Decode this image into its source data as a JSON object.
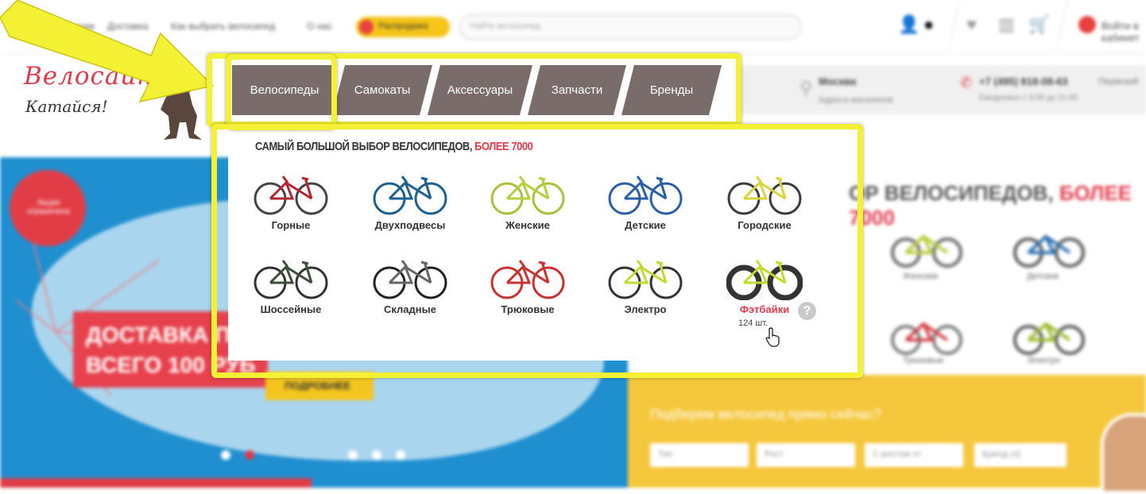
{
  "topbar": {
    "links": [
      "Акция праздник",
      "Доставка",
      "Как выбрать велосипед",
      "О нас"
    ],
    "promo_label": "Распродажа",
    "search_placeholder": "Найти велосипед",
    "login_label": "Войти в кабинет"
  },
  "logo": {
    "title": "Велосайт",
    "subtitle": "Катайся!"
  },
  "nav": {
    "items": [
      "Велосипеды",
      "Самокаты",
      "Аксессуары",
      "Запчасти",
      "Бренды"
    ]
  },
  "contact": {
    "city": "Москва",
    "city_sub": "Адреса магазинов",
    "phone": "+7 (495) 818-08-63",
    "phone_extra": "Пермский",
    "hours": "Ежедневно с 9:00 до 21:00"
  },
  "dropdown": {
    "heading_main": "Самый большой выбор велосипедов,",
    "heading_accent": " более 7000",
    "categories": [
      {
        "label": "Горные"
      },
      {
        "label": "Двухподвесы"
      },
      {
        "label": "Женские"
      },
      {
        "label": "Детские"
      },
      {
        "label": "Городские"
      },
      {
        "label": "Шоссейные"
      },
      {
        "label": "Складные"
      },
      {
        "label": "Трюковые"
      },
      {
        "label": "Электро"
      },
      {
        "label": "Фэтбайки"
      }
    ],
    "active_count": "124 шт.",
    "help_symbol": "?"
  },
  "background": {
    "badge": "Акция ограничена",
    "delivery_line1": "ДОСТАВКА ПО",
    "delivery_line2": "ВСЕГО 100 РУБ",
    "more_button": "ПОДРОБНЕЕ",
    "right_heading_main": "ОР ВЕЛОСИПЕДОВ,",
    "right_heading_accent": " БОЛЕЕ 7000",
    "right_labels": [
      "Женские",
      "Детские",
      "Трюковые",
      "Электро"
    ],
    "quiz_title": "Подберем велосипед прямо сейчас?",
    "quiz_selects": [
      "Тип",
      "Рост",
      "С ростом от",
      "Бренд (4)"
    ]
  },
  "colors": {
    "accent_red": "#e0394a",
    "nav_bg": "#7a6c6a",
    "highlight_yellow": "#f4f034",
    "hero_blue": "#1f8fd0",
    "quiz_yellow": "#f5c73d"
  }
}
